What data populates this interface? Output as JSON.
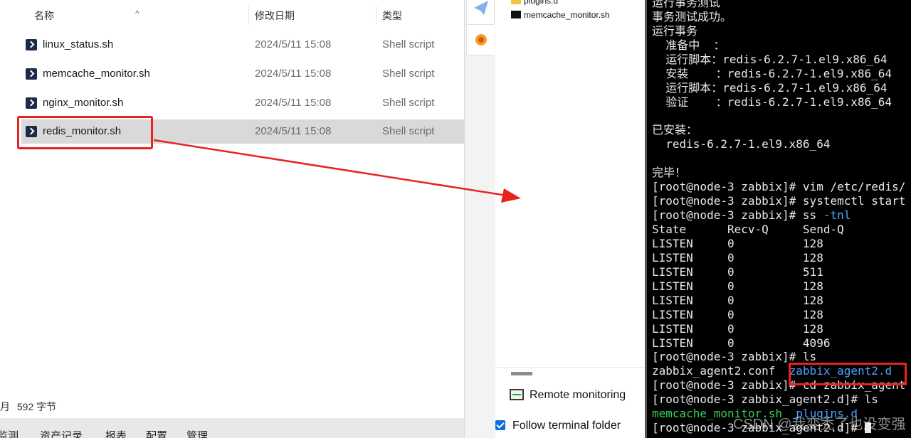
{
  "explorer": {
    "columns": {
      "name": "名称",
      "date": "修改日期",
      "type": "类型"
    },
    "files": [
      {
        "name": "linux_status.sh",
        "date": "2024/5/11 15:08",
        "type": "Shell script"
      },
      {
        "name": "memcache_monitor.sh",
        "date": "2024/5/11 15:08",
        "type": "Shell script"
      },
      {
        "name": "nginx_monitor.sh",
        "date": "2024/5/11 15:08",
        "type": "Shell script"
      },
      {
        "name": "redis_monitor.sh",
        "date": "2024/5/11 15:08",
        "type": "Shell script",
        "selected": true
      }
    ],
    "status_text": "592 字节",
    "bottom_tabs": [
      "监测",
      "资产记录",
      "报表",
      "配置",
      "管理"
    ]
  },
  "sidebar": {
    "tree": [
      {
        "name": "plugins.d",
        "icon": "folder-icon"
      },
      {
        "name": "memcache_monitor.sh",
        "icon": "shell-file-icon"
      }
    ],
    "remote_monitoring_label": "Remote monitoring",
    "follow_terminal_label": "Follow terminal folder"
  },
  "terminal": {
    "lines": [
      [
        {
          "t": "运行事务测试"
        }
      ],
      [
        {
          "t": "事务测试成功。"
        }
      ],
      [
        {
          "t": "运行事务"
        }
      ],
      [
        {
          "t": "  准备中  ："
        }
      ],
      [
        {
          "t": "  运行脚本：redis-6.2.7-1.el9.x86_64"
        }
      ],
      [
        {
          "t": "  安装    ：redis-6.2.7-1.el9.x86_64"
        }
      ],
      [
        {
          "t": "  运行脚本：redis-6.2.7-1.el9.x86_64"
        }
      ],
      [
        {
          "t": "  验证    ：redis-6.2.7-1.el9.x86_64"
        }
      ],
      [
        {
          "t": ""
        }
      ],
      [
        {
          "t": "已安装："
        }
      ],
      [
        {
          "t": "  redis-6.2.7-1.el9.x86_64"
        }
      ],
      [
        {
          "t": ""
        }
      ],
      [
        {
          "t": "完毕！"
        }
      ],
      [
        {
          "t": "[root@node-3 zabbix]# vim /etc/redis/"
        }
      ],
      [
        {
          "t": "[root@node-3 zabbix]# systemctl start"
        }
      ],
      [
        {
          "t": "[root@node-3 zabbix]# ss "
        },
        {
          "t": "-tnl",
          "c": "blue"
        }
      ],
      [
        {
          "t": "State      Recv-Q     Send-Q"
        }
      ],
      [
        {
          "t": "LISTEN     0          128"
        }
      ],
      [
        {
          "t": "LISTEN     0          128"
        }
      ],
      [
        {
          "t": "LISTEN     0          511"
        }
      ],
      [
        {
          "t": "LISTEN     0          128"
        }
      ],
      [
        {
          "t": "LISTEN     0          128"
        }
      ],
      [
        {
          "t": "LISTEN     0          128"
        }
      ],
      [
        {
          "t": "LISTEN     0          128"
        }
      ],
      [
        {
          "t": "LISTEN     0          4096"
        }
      ],
      [
        {
          "t": "[root@node-3 zabbix]# ls"
        }
      ],
      [
        {
          "t": "zabbix_agent2.conf  "
        },
        {
          "t": "zabbix_agent2.d",
          "c": "blue"
        }
      ],
      [
        {
          "t": "[root@node-3 zabbix]# cd zabbix_agent"
        }
      ],
      [
        {
          "t": "[root@node-3 zabbix_agent2.d]# ls"
        }
      ],
      [
        {
          "t": "memcache_monitor.sh  ",
          "c": "green"
        },
        {
          "t": "plugins.d",
          "c": "blue"
        }
      ],
      [
        {
          "t": "[root@node-3 zabbix_agent2.d]# "
        },
        {
          "t": "",
          "cursor": true
        }
      ]
    ]
  },
  "watermark": "CSDN @我变秃了也没变强",
  "colors": {
    "annotation_red": "#e8231f",
    "term_blue": "#4aa4ff",
    "term_green": "#35d35a"
  }
}
